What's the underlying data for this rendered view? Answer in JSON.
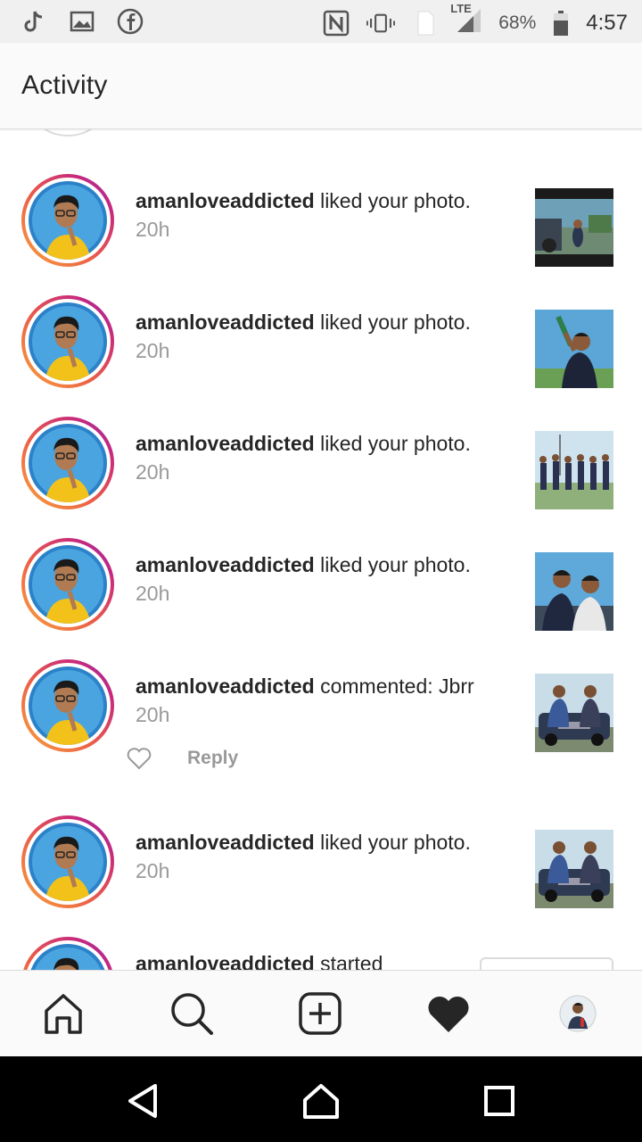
{
  "status_bar": {
    "network": "LTE",
    "battery": "68%",
    "time": "4:57",
    "icons": [
      "tiktok-icon",
      "gallery-icon",
      "facebook-icon",
      "nfc-icon",
      "vibrate-icon",
      "sim-icon",
      "signal-icon",
      "battery-icon"
    ]
  },
  "header": {
    "title": "Activity"
  },
  "activity": [
    {
      "username": "amanloveaddicted",
      "action": " liked your photo.",
      "time": "20h",
      "thumb": "thumb-1"
    },
    {
      "username": "amanloveaddicted",
      "action": " liked your photo.",
      "time": "20h",
      "thumb": "thumb-2"
    },
    {
      "username": "amanloveaddicted",
      "action": " liked your photo.",
      "time": "20h",
      "thumb": "thumb-3"
    },
    {
      "username": "amanloveaddicted",
      "action": " liked your photo.",
      "time": "20h",
      "thumb": "thumb-4"
    },
    {
      "username": "amanloveaddicted",
      "action": " commented: Jbrr",
      "time": "20h",
      "thumb": "thumb-5",
      "reply_label": "Reply"
    },
    {
      "username": "amanloveaddicted",
      "action": " liked your photo.",
      "time": "20h",
      "thumb": "thumb-6"
    },
    {
      "username": "amanloveaddicted",
      "action": " started",
      "time": ""
    }
  ],
  "bottom_nav": [
    "home-icon",
    "search-icon",
    "new-post-icon",
    "activity-heart-icon",
    "profile-avatar"
  ],
  "android_nav": [
    "back-icon",
    "home-icon",
    "recents-icon"
  ],
  "colors": {
    "ring_start": "#f9a43b",
    "ring_mid": "#ea5a4a",
    "ring_end": "#c6287e",
    "username": "#262626",
    "timestamp": "#999999"
  }
}
